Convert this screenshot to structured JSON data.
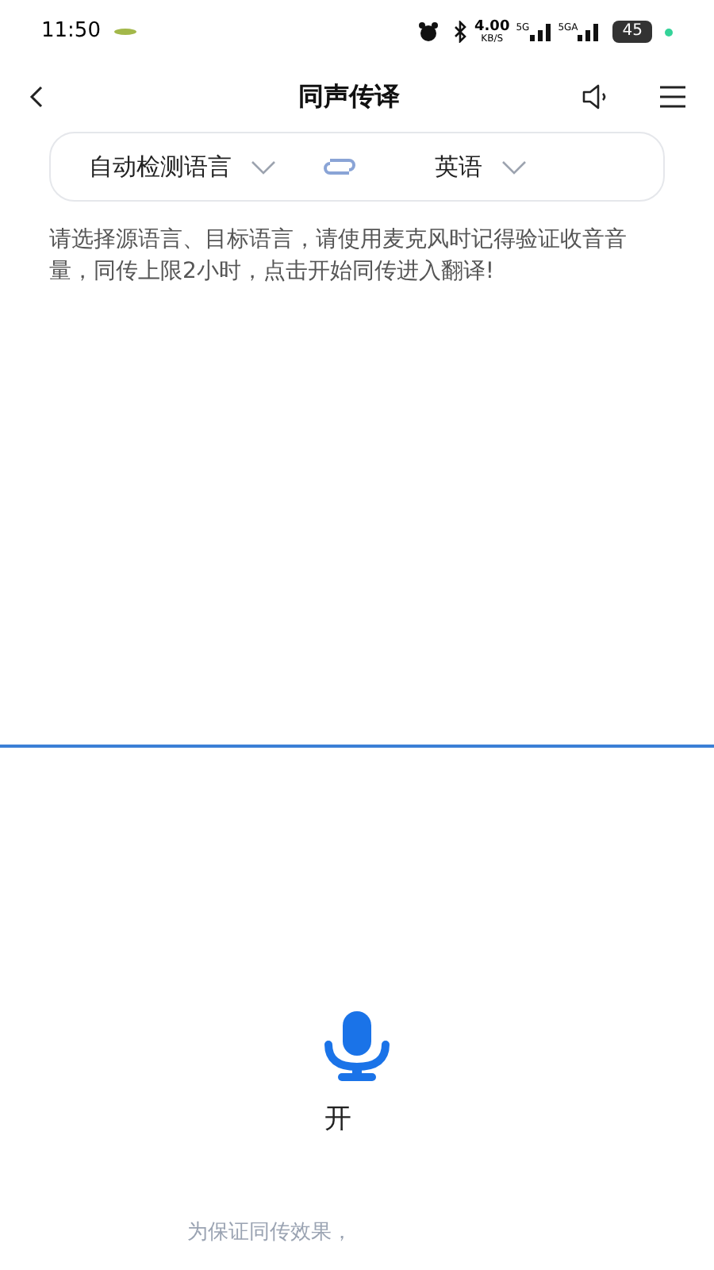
{
  "status_bar": {
    "time": "11:50",
    "speed": "4.00",
    "speed_unit": "KB/S",
    "network_1": "5G",
    "network_2": "5GA",
    "battery": "45"
  },
  "header": {
    "title": "同声传译"
  },
  "language_bar": {
    "source": "自动检测语言",
    "target": "英语"
  },
  "instructions": "请选择源语言、目标语言，请使用麦克风时记得验证收音音量，同传上限2小时，点击开始同传进入翻译!",
  "start": {
    "label": "开"
  },
  "footer_note": "为保证同传效果，"
}
